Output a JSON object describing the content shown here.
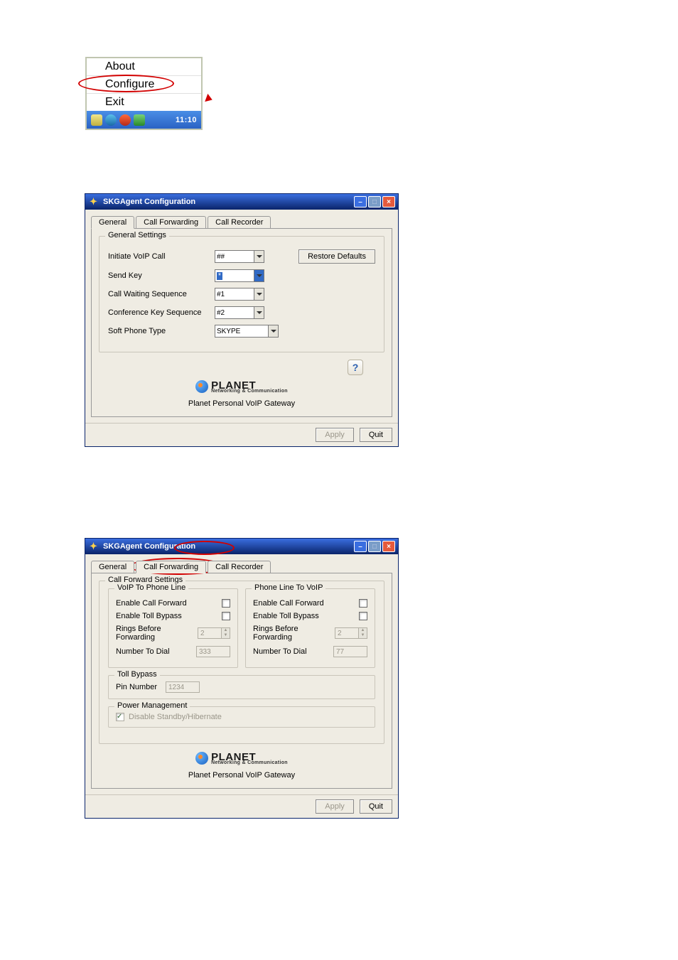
{
  "context_menu": {
    "items": [
      "About",
      "Configure",
      "Exit"
    ]
  },
  "taskbar": {
    "time": "11:10"
  },
  "win1": {
    "title": "SKGAgent Configuration",
    "tabs": [
      "General",
      "Call Forwarding",
      "Call Recorder"
    ],
    "active_tab": 0,
    "general": {
      "group_title": "General Settings",
      "rows": {
        "initiate": {
          "label": "Initiate VoIP Call",
          "value": "##"
        },
        "send": {
          "label": "Send Key",
          "value": "*"
        },
        "cws": {
          "label": "Call Waiting Sequence",
          "value": "#1"
        },
        "confkey": {
          "label": "Conference Key Sequence",
          "value": "#2"
        },
        "softphone": {
          "label": "Soft Phone Type",
          "value": "SKYPE"
        }
      },
      "restore_btn": "Restore Defaults"
    },
    "help_label": "?",
    "brand": {
      "name": "PLANET",
      "sub": "Networking & Communication"
    },
    "caption": "Planet Personal VoIP Gateway",
    "buttons": {
      "apply": "Apply",
      "quit": "Quit"
    }
  },
  "win2": {
    "title": "SKGAgent Configuration",
    "tabs": [
      "General",
      "Call Forwarding",
      "Call Recorder"
    ],
    "active_tab": 1,
    "cf": {
      "group_title": "Call Forward Settings",
      "left": {
        "title": "VoIP To Phone Line",
        "enable_cf": "Enable Call Forward",
        "enable_tb": "Enable Toll Bypass",
        "rings": "Rings Before Forwarding",
        "rings_value": "2",
        "number": "Number To Dial",
        "number_value": "333"
      },
      "right": {
        "title": "Phone Line To VoIP",
        "enable_cf": "Enable Call Forward",
        "enable_tb": "Enable Toll Bypass",
        "rings": "Rings Before Forwarding",
        "rings_value": "2",
        "number": "Number To Dial",
        "number_value": "77"
      },
      "toll": {
        "title": "Toll Bypass",
        "pin_label": "Pin Number",
        "pin_value": "1234"
      },
      "power": {
        "title": "Power Management",
        "checkbox": "Disable Standby/Hibernate"
      }
    },
    "brand": {
      "name": "PLANET",
      "sub": "Networking & Communication"
    },
    "caption": "Planet Personal VoIP Gateway",
    "buttons": {
      "apply": "Apply",
      "quit": "Quit"
    }
  }
}
